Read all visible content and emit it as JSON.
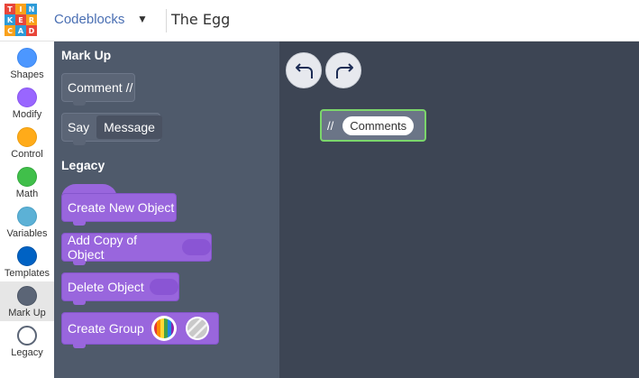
{
  "header": {
    "logo_letters": [
      "T",
      "I",
      "N",
      "K",
      "E",
      "R",
      "C",
      "A",
      "D"
    ],
    "breadcrumb": "Codeblocks",
    "project_title": "The Egg"
  },
  "categories": [
    {
      "label": "Shapes",
      "color": "#4c97ff"
    },
    {
      "label": "Modify",
      "color": "#9966ff"
    },
    {
      "label": "Control",
      "color": "#ffab19"
    },
    {
      "label": "Math",
      "color": "#40bf4a"
    },
    {
      "label": "Variables",
      "color": "#5cb1d6"
    },
    {
      "label": "Templates",
      "color": "#0062c4"
    },
    {
      "label": "Mark Up",
      "color": "#5b6576"
    },
    {
      "label": "Legacy",
      "color": "#ffffff"
    }
  ],
  "selected_category": "Mark Up",
  "flyout": {
    "markup_title": "Mark Up",
    "comment_block": "Comment //",
    "say_label": "Say",
    "say_value": "Message",
    "legacy_title": "Legacy",
    "create_new_object": "Create New Object",
    "add_copy_of_object": "Add Copy of Object",
    "delete_object": "Delete Object",
    "create_group": "Create Group"
  },
  "workspace": {
    "comment_slash": "//",
    "comment_value": "Comments"
  },
  "colors": {
    "flyout_bg": "#4f5a6b",
    "workspace_bg": "#3d4554",
    "legacy_block": "#9966dd",
    "highlight": "#7bd66b"
  }
}
